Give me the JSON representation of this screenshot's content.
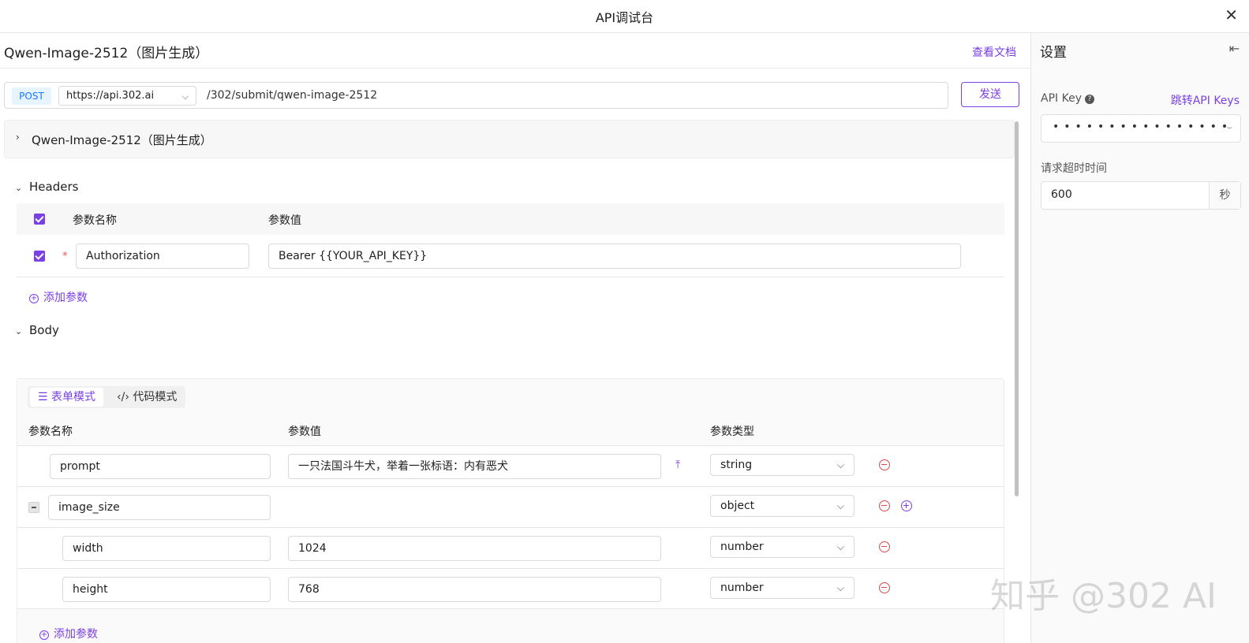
{
  "window": {
    "title": "API调试台",
    "close_icon": "close-icon"
  },
  "header": {
    "title": "Qwen-Image-2512（图片生成）",
    "doc_link": "查看文档"
  },
  "request": {
    "method": "POST",
    "host": "https://api.302.ai",
    "path": "/302/submit/qwen-image-2512",
    "send_label": "发送"
  },
  "description_section": {
    "label": "Qwen-Image-2512（图片生成）"
  },
  "headers_section": {
    "label": "Headers",
    "col_name": "参数名称",
    "col_value": "参数值",
    "rows": [
      {
        "name": "Authorization",
        "value": "Bearer {{YOUR_API_KEY}}",
        "required_mark": "*"
      }
    ],
    "add_label": "添加参数"
  },
  "body_section": {
    "label": "Body",
    "tab_form": "表单模式",
    "tab_code": "代码模式",
    "col_name": "参数名称",
    "col_value": "参数值",
    "col_type": "参数类型",
    "rows": [
      {
        "name": "prompt",
        "value": "一只法国斗牛犬，举着一张标语：内有恶犬",
        "type": "string"
      },
      {
        "name": "image_size",
        "value": "",
        "type": "object"
      },
      {
        "name": "width",
        "value": "1024",
        "type": "number"
      },
      {
        "name": "height",
        "value": "768",
        "type": "number"
      }
    ],
    "add_label": "添加参数"
  },
  "settings": {
    "title": "设置",
    "api_key_label": "API Key",
    "api_key_help": "?",
    "api_key_link": "跳转API Keys",
    "api_key_value": "••••••••••••••••",
    "timeout_label": "请求超时时间",
    "timeout_value": "600",
    "timeout_unit": "秒"
  },
  "watermark": "知乎 @302 AI",
  "colors": {
    "accent": "#7b3fe4",
    "method_bg": "#e6f4ff",
    "method_text": "#1677ff",
    "danger": "#e04848"
  }
}
